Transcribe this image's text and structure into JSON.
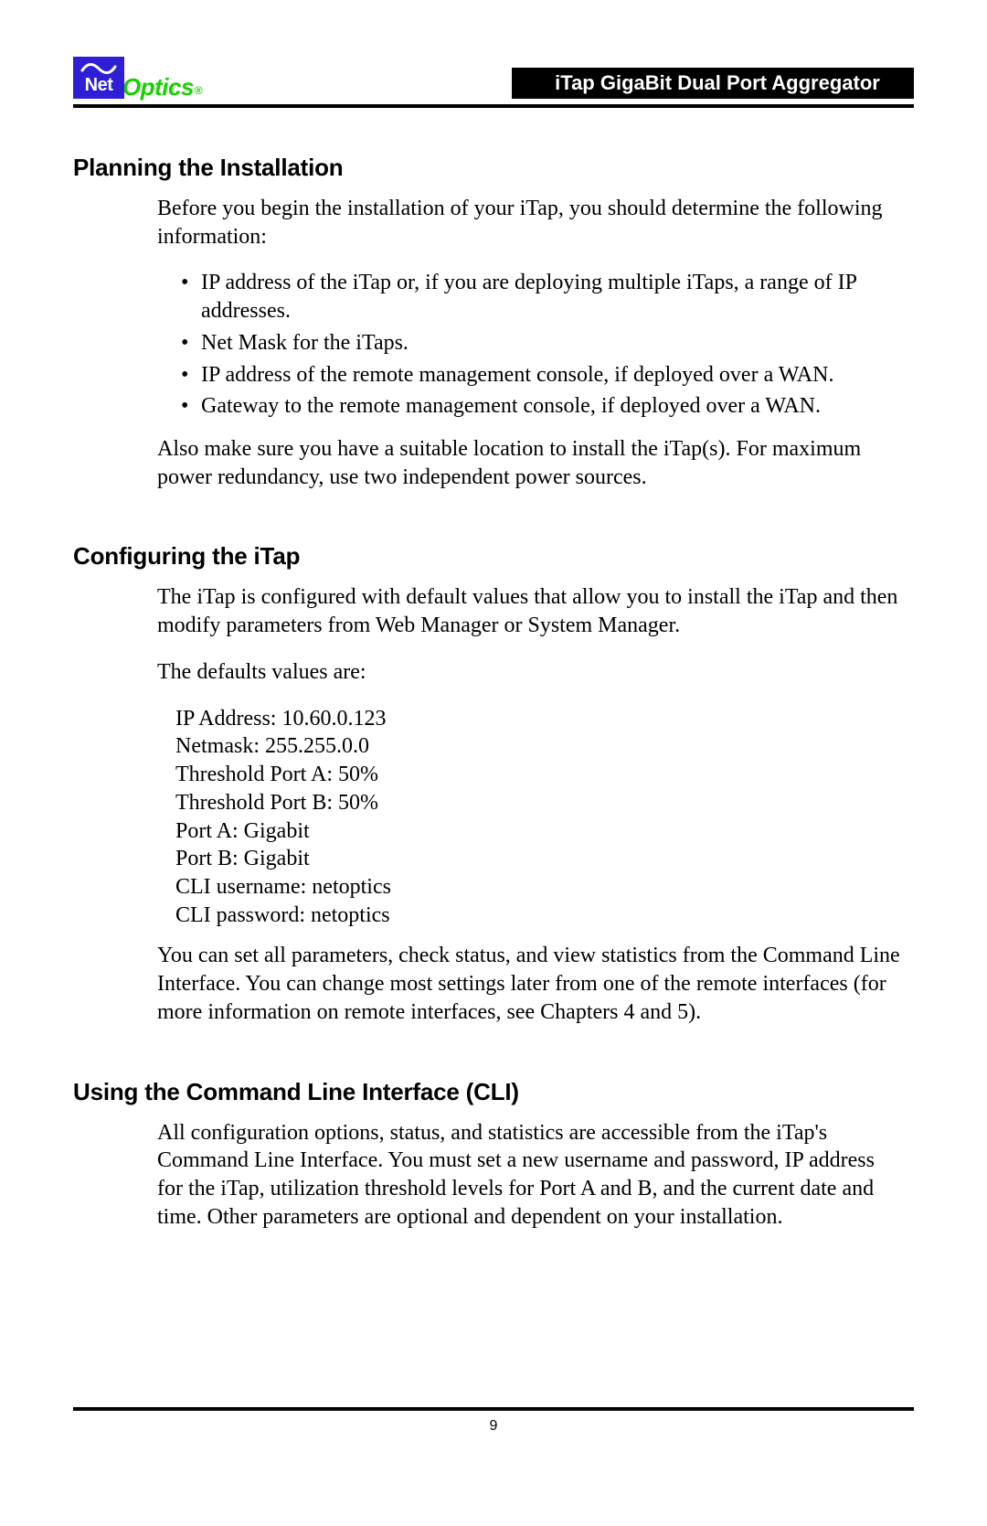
{
  "header": {
    "logo_net": "Net",
    "logo_optics": "Optics",
    "logo_reg": "®",
    "product_title": "iTap GigaBit Dual Port Aggregator"
  },
  "sections": {
    "planning": {
      "heading": "Planning the Installation",
      "intro": "Before you begin the installation of your iTap, you should determine the following information:",
      "bullets": [
        "IP address of the iTap or, if you are deploying multiple iTaps, a range of IP addresses.",
        "Net Mask for the iTaps.",
        "IP address of the remote management console, if deployed over a WAN.",
        "Gateway to the remote management console, if deployed over a WAN."
      ],
      "after": "Also make sure you have a suitable location to install the iTap(s). For maximum power redundancy, use two independent power sources."
    },
    "configuring": {
      "heading": "Configuring the iTap",
      "intro": "The iTap is configured with default values that allow you to install the iTap and then modify parameters from Web Manager or System Manager.",
      "defaults_label": "The defaults values are:",
      "defaults": {
        "ip_address": "IP Address: 10.60.0.123",
        "netmask": "Netmask: 255.255.0.0",
        "threshold_a": "Threshold Port A: 50%",
        "threshold_b": "Threshold Port B: 50%",
        "port_a": "Port A: Gigabit",
        "port_b": "Port B: Gigabit",
        "cli_user": "CLI username: netoptics",
        "cli_pass": "CLI password: netoptics"
      },
      "after": "You can set all parameters, check status, and view statistics from the Command Line Interface. You can change most settings later from one of the remote interfaces (for more information on remote interfaces, see Chapters 4 and 5)."
    },
    "cli": {
      "heading": "Using the Command Line Interface (CLI)",
      "intro": "All configuration options, status, and statistics are accessible from the iTap's Command Line Interface. You must set a new username and password, IP address for the iTap, utilization threshold levels for Port A and B, and the current date and time. Other parameters are optional and dependent on your installation."
    }
  },
  "footer": {
    "page_number": "9"
  }
}
